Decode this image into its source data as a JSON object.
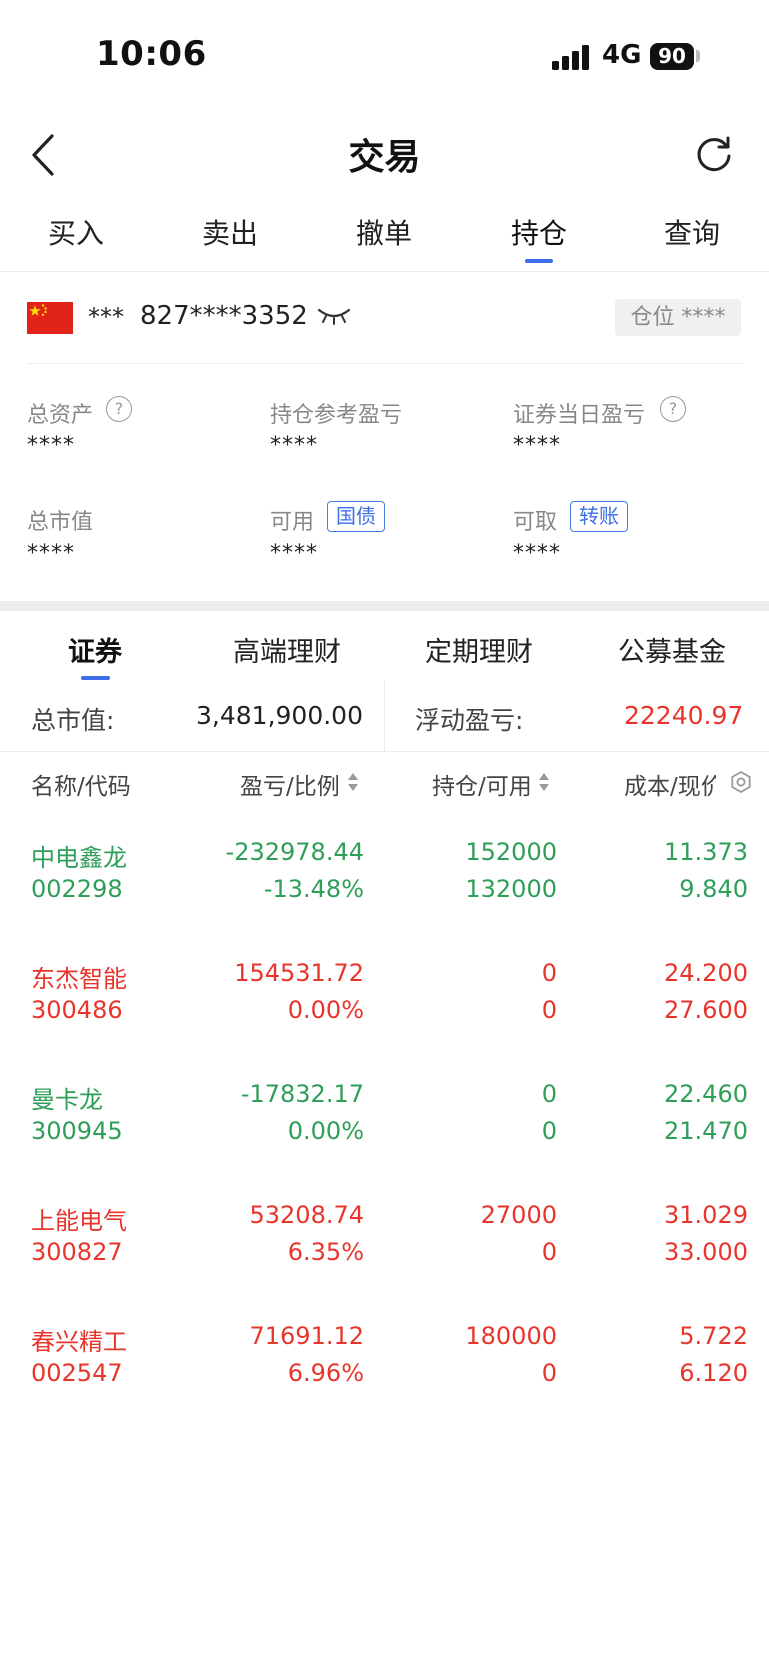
{
  "status_bar": {
    "time": "10:06",
    "network": "4G",
    "battery": "90"
  },
  "header": {
    "title": "交易"
  },
  "top_tabs": [
    {
      "label": "买入"
    },
    {
      "label": "卖出"
    },
    {
      "label": "撤单"
    },
    {
      "label": "持仓",
      "active": true
    },
    {
      "label": "查询"
    }
  ],
  "account": {
    "prefix": "***",
    "number": "827****3352",
    "position_label": "仓位 ****"
  },
  "stats": {
    "total_assets": {
      "label": "总资产",
      "value": "****"
    },
    "position_pnl": {
      "label": "持仓参考盈亏",
      "value": "****"
    },
    "daily_pnl": {
      "label": "证券当日盈亏",
      "value": "****"
    },
    "market_value": {
      "label": "总市值",
      "value": "****"
    },
    "available": {
      "label": "可用",
      "tag": "国债",
      "value": "****"
    },
    "withdrawable": {
      "label": "可取",
      "tag": "转账",
      "value": "****"
    }
  },
  "product_tabs": [
    {
      "label": "证券",
      "active": true
    },
    {
      "label": "高端理财"
    },
    {
      "label": "定期理财"
    },
    {
      "label": "公募基金"
    }
  ],
  "summary": {
    "market_value_label": "总市值:",
    "market_value": "3,481,900.00",
    "floating_pnl_label": "浮动盈亏:",
    "floating_pnl": "22240.97"
  },
  "columns": {
    "name": "名称/代码",
    "pnl": "盈亏/比例",
    "holding": "持仓/可用",
    "cost": "成本/现价"
  },
  "colors": {
    "up": "#e8352c",
    "down": "#2e9e58",
    "accent": "#3b6ee8"
  },
  "holdings": [
    {
      "name": "中电鑫龙",
      "code": "002298",
      "pnl": "-232978.44",
      "ratio": "-13.48%",
      "position": "152000",
      "available": "132000",
      "cost": "11.373",
      "price": "9.840",
      "trend": "down"
    },
    {
      "name": "东杰智能",
      "code": "300486",
      "pnl": "154531.72",
      "ratio": "0.00%",
      "position": "0",
      "available": "0",
      "cost": "24.200",
      "price": "27.600",
      "trend": "up"
    },
    {
      "name": "曼卡龙",
      "code": "300945",
      "pnl": "-17832.17",
      "ratio": "0.00%",
      "position": "0",
      "available": "0",
      "cost": "22.460",
      "price": "21.470",
      "trend": "down"
    },
    {
      "name": "上能电气",
      "code": "300827",
      "pnl": "53208.74",
      "ratio": "6.35%",
      "position": "27000",
      "available": "0",
      "cost": "31.029",
      "price": "33.000",
      "trend": "up"
    },
    {
      "name": "春兴精工",
      "code": "002547",
      "pnl": "71691.12",
      "ratio": "6.96%",
      "position": "180000",
      "available": "0",
      "cost": "5.722",
      "price": "6.120",
      "trend": "up"
    }
  ]
}
